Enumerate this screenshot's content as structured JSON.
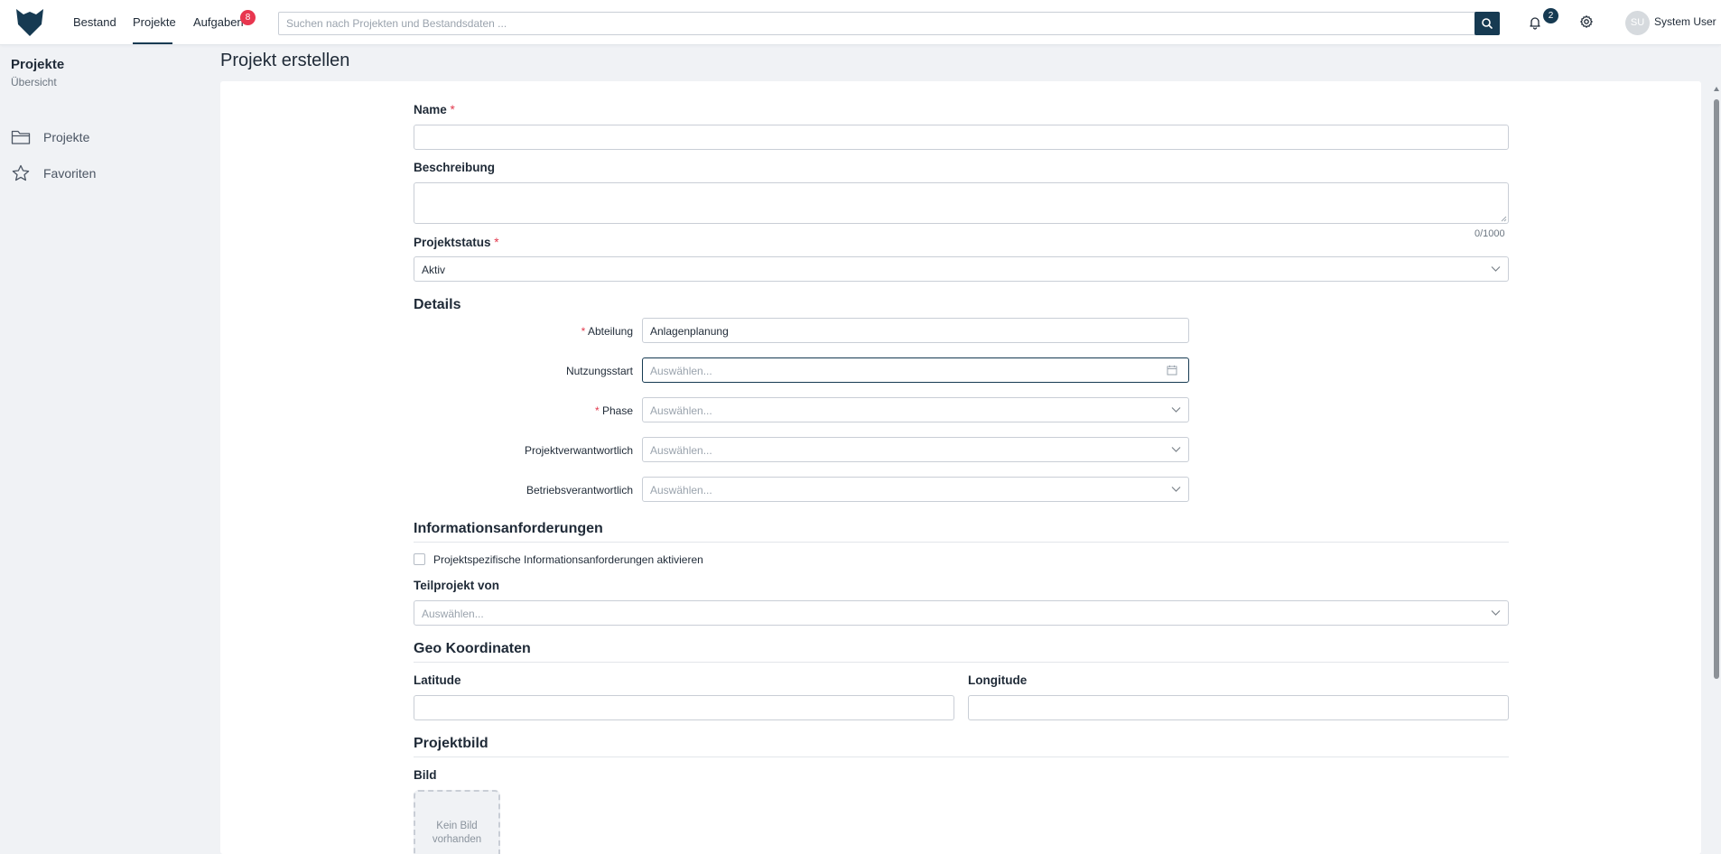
{
  "nav": {
    "items": [
      {
        "label": "Bestand"
      },
      {
        "label": "Projekte"
      },
      {
        "label": "Aufgaben"
      }
    ],
    "tasks_badge": "8",
    "notifications_badge": "2"
  },
  "search": {
    "placeholder": "Suchen nach Projekten und Bestandsdaten ..."
  },
  "user": {
    "initials": "SU",
    "name": "System User"
  },
  "sidebar": {
    "title": "Projekte",
    "subtitle": "Übersicht",
    "items": [
      {
        "label": "Projekte",
        "icon": "folder-icon"
      },
      {
        "label": "Favoriten",
        "icon": "star-icon"
      }
    ]
  },
  "page": {
    "title": "Projekt erstellen"
  },
  "form": {
    "name_label": "Name",
    "required_mark": "*",
    "name_value": "",
    "description_label": "Beschreibung",
    "description_value": "",
    "description_counter": "0/1000",
    "status_label": "Projektstatus",
    "status_value": "Aktiv",
    "details_heading": "Details",
    "details": {
      "abteilung_label": "Abteilung",
      "abteilung_value": "Anlagenplanung",
      "nutzungsstart_label": "Nutzungsstart",
      "nutzungsstart_placeholder": "Auswählen...",
      "phase_label": "Phase",
      "phase_placeholder": "Auswählen...",
      "projektverantwortlich_label": "Projektverwantwortlich",
      "projektverantwortlich_placeholder": "Auswählen...",
      "betriebsverantwortlich_label": "Betriebsverantwortlich",
      "betriebsverantwortlich_placeholder": "Auswählen..."
    },
    "info_heading": "Informationsanforderungen",
    "info_checkbox_label": "Projektspezifische Informationsanforderungen aktivieren",
    "info_checkbox_checked": false,
    "teilprojekt_label": "Teilprojekt von",
    "teilprojekt_placeholder": "Auswählen...",
    "geo_heading": "Geo Koordinaten",
    "latitude_label": "Latitude",
    "latitude_value": "",
    "longitude_label": "Longitude",
    "longitude_value": "",
    "bild_heading": "Projektbild",
    "bild_label": "Bild",
    "bild_empty_line1": "Kein Bild",
    "bild_empty_line2": "vorhanden"
  },
  "colors": {
    "primary": "#163a52",
    "required": "#e23a4e",
    "badge_red": "#e8364f"
  }
}
